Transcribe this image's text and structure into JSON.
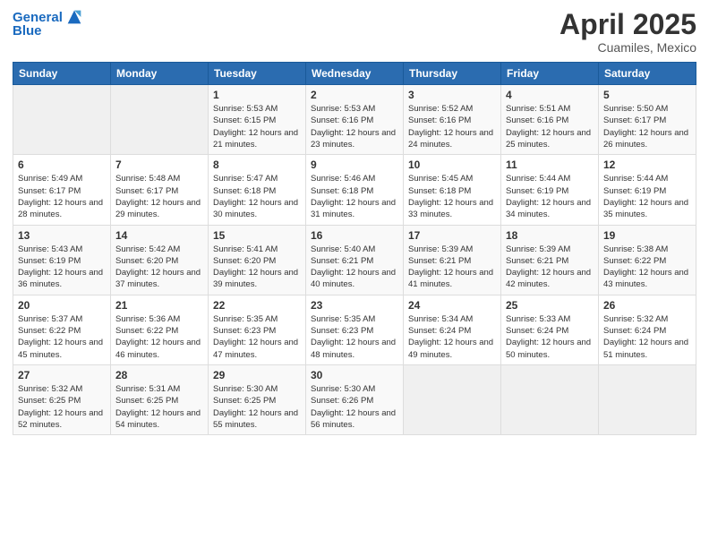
{
  "header": {
    "logo_line1": "General",
    "logo_line2": "Blue",
    "title": "April 2025",
    "subtitle": "Cuamiles, Mexico"
  },
  "weekdays": [
    "Sunday",
    "Monday",
    "Tuesday",
    "Wednesday",
    "Thursday",
    "Friday",
    "Saturday"
  ],
  "weeks": [
    [
      {
        "day": "",
        "sunrise": "",
        "sunset": "",
        "daylight": ""
      },
      {
        "day": "",
        "sunrise": "",
        "sunset": "",
        "daylight": ""
      },
      {
        "day": "1",
        "sunrise": "Sunrise: 5:53 AM",
        "sunset": "Sunset: 6:15 PM",
        "daylight": "Daylight: 12 hours and 21 minutes."
      },
      {
        "day": "2",
        "sunrise": "Sunrise: 5:53 AM",
        "sunset": "Sunset: 6:16 PM",
        "daylight": "Daylight: 12 hours and 23 minutes."
      },
      {
        "day": "3",
        "sunrise": "Sunrise: 5:52 AM",
        "sunset": "Sunset: 6:16 PM",
        "daylight": "Daylight: 12 hours and 24 minutes."
      },
      {
        "day": "4",
        "sunrise": "Sunrise: 5:51 AM",
        "sunset": "Sunset: 6:16 PM",
        "daylight": "Daylight: 12 hours and 25 minutes."
      },
      {
        "day": "5",
        "sunrise": "Sunrise: 5:50 AM",
        "sunset": "Sunset: 6:17 PM",
        "daylight": "Daylight: 12 hours and 26 minutes."
      }
    ],
    [
      {
        "day": "6",
        "sunrise": "Sunrise: 5:49 AM",
        "sunset": "Sunset: 6:17 PM",
        "daylight": "Daylight: 12 hours and 28 minutes."
      },
      {
        "day": "7",
        "sunrise": "Sunrise: 5:48 AM",
        "sunset": "Sunset: 6:17 PM",
        "daylight": "Daylight: 12 hours and 29 minutes."
      },
      {
        "day": "8",
        "sunrise": "Sunrise: 5:47 AM",
        "sunset": "Sunset: 6:18 PM",
        "daylight": "Daylight: 12 hours and 30 minutes."
      },
      {
        "day": "9",
        "sunrise": "Sunrise: 5:46 AM",
        "sunset": "Sunset: 6:18 PM",
        "daylight": "Daylight: 12 hours and 31 minutes."
      },
      {
        "day": "10",
        "sunrise": "Sunrise: 5:45 AM",
        "sunset": "Sunset: 6:18 PM",
        "daylight": "Daylight: 12 hours and 33 minutes."
      },
      {
        "day": "11",
        "sunrise": "Sunrise: 5:44 AM",
        "sunset": "Sunset: 6:19 PM",
        "daylight": "Daylight: 12 hours and 34 minutes."
      },
      {
        "day": "12",
        "sunrise": "Sunrise: 5:44 AM",
        "sunset": "Sunset: 6:19 PM",
        "daylight": "Daylight: 12 hours and 35 minutes."
      }
    ],
    [
      {
        "day": "13",
        "sunrise": "Sunrise: 5:43 AM",
        "sunset": "Sunset: 6:19 PM",
        "daylight": "Daylight: 12 hours and 36 minutes."
      },
      {
        "day": "14",
        "sunrise": "Sunrise: 5:42 AM",
        "sunset": "Sunset: 6:20 PM",
        "daylight": "Daylight: 12 hours and 37 minutes."
      },
      {
        "day": "15",
        "sunrise": "Sunrise: 5:41 AM",
        "sunset": "Sunset: 6:20 PM",
        "daylight": "Daylight: 12 hours and 39 minutes."
      },
      {
        "day": "16",
        "sunrise": "Sunrise: 5:40 AM",
        "sunset": "Sunset: 6:21 PM",
        "daylight": "Daylight: 12 hours and 40 minutes."
      },
      {
        "day": "17",
        "sunrise": "Sunrise: 5:39 AM",
        "sunset": "Sunset: 6:21 PM",
        "daylight": "Daylight: 12 hours and 41 minutes."
      },
      {
        "day": "18",
        "sunrise": "Sunrise: 5:39 AM",
        "sunset": "Sunset: 6:21 PM",
        "daylight": "Daylight: 12 hours and 42 minutes."
      },
      {
        "day": "19",
        "sunrise": "Sunrise: 5:38 AM",
        "sunset": "Sunset: 6:22 PM",
        "daylight": "Daylight: 12 hours and 43 minutes."
      }
    ],
    [
      {
        "day": "20",
        "sunrise": "Sunrise: 5:37 AM",
        "sunset": "Sunset: 6:22 PM",
        "daylight": "Daylight: 12 hours and 45 minutes."
      },
      {
        "day": "21",
        "sunrise": "Sunrise: 5:36 AM",
        "sunset": "Sunset: 6:22 PM",
        "daylight": "Daylight: 12 hours and 46 minutes."
      },
      {
        "day": "22",
        "sunrise": "Sunrise: 5:35 AM",
        "sunset": "Sunset: 6:23 PM",
        "daylight": "Daylight: 12 hours and 47 minutes."
      },
      {
        "day": "23",
        "sunrise": "Sunrise: 5:35 AM",
        "sunset": "Sunset: 6:23 PM",
        "daylight": "Daylight: 12 hours and 48 minutes."
      },
      {
        "day": "24",
        "sunrise": "Sunrise: 5:34 AM",
        "sunset": "Sunset: 6:24 PM",
        "daylight": "Daylight: 12 hours and 49 minutes."
      },
      {
        "day": "25",
        "sunrise": "Sunrise: 5:33 AM",
        "sunset": "Sunset: 6:24 PM",
        "daylight": "Daylight: 12 hours and 50 minutes."
      },
      {
        "day": "26",
        "sunrise": "Sunrise: 5:32 AM",
        "sunset": "Sunset: 6:24 PM",
        "daylight": "Daylight: 12 hours and 51 minutes."
      }
    ],
    [
      {
        "day": "27",
        "sunrise": "Sunrise: 5:32 AM",
        "sunset": "Sunset: 6:25 PM",
        "daylight": "Daylight: 12 hours and 52 minutes."
      },
      {
        "day": "28",
        "sunrise": "Sunrise: 5:31 AM",
        "sunset": "Sunset: 6:25 PM",
        "daylight": "Daylight: 12 hours and 54 minutes."
      },
      {
        "day": "29",
        "sunrise": "Sunrise: 5:30 AM",
        "sunset": "Sunset: 6:25 PM",
        "daylight": "Daylight: 12 hours and 55 minutes."
      },
      {
        "day": "30",
        "sunrise": "Sunrise: 5:30 AM",
        "sunset": "Sunset: 6:26 PM",
        "daylight": "Daylight: 12 hours and 56 minutes."
      },
      {
        "day": "",
        "sunrise": "",
        "sunset": "",
        "daylight": ""
      },
      {
        "day": "",
        "sunrise": "",
        "sunset": "",
        "daylight": ""
      },
      {
        "day": "",
        "sunrise": "",
        "sunset": "",
        "daylight": ""
      }
    ]
  ]
}
